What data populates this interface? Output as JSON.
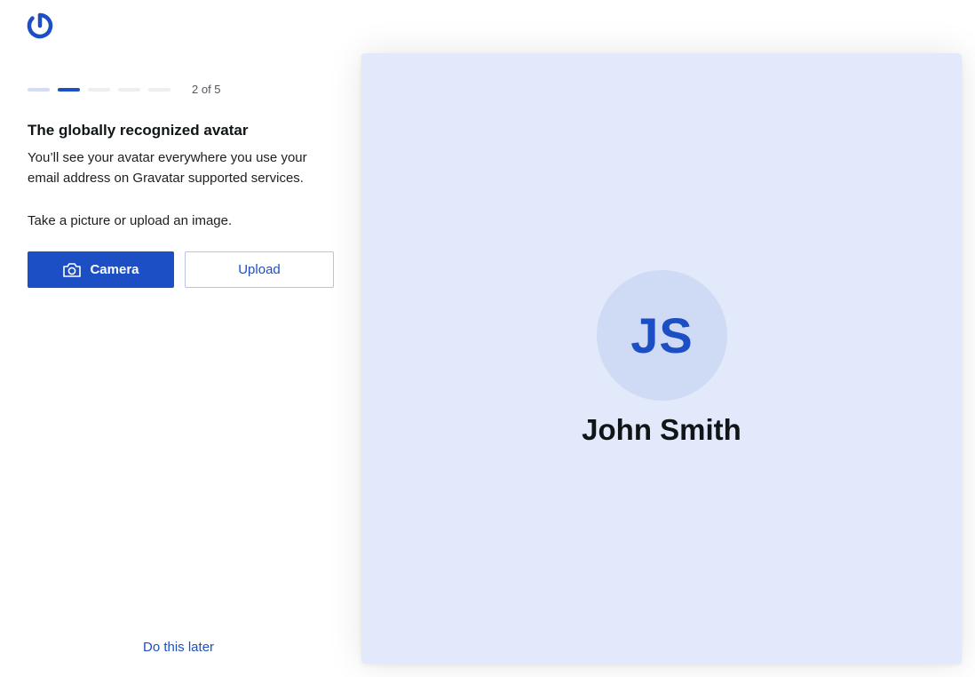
{
  "brand": {
    "logo_icon": "gravatar-logo-icon",
    "accent_color": "#1d4fc4"
  },
  "progress": {
    "steps_total": 5,
    "current_step": 2,
    "label": "2 of 5"
  },
  "onboarding": {
    "heading": "The globally recognized avatar",
    "description": "You’ll see your avatar everywhere you use your email address on Gravatar supported services.",
    "hint": "Take a picture or upload an image."
  },
  "actions": {
    "camera_label": "Camera",
    "camera_icon": "camera-icon",
    "upload_label": "Upload",
    "skip_label": "Do this later"
  },
  "preview": {
    "initials": "JS",
    "name": "John Smith",
    "background_color": "#e2e9fb"
  }
}
